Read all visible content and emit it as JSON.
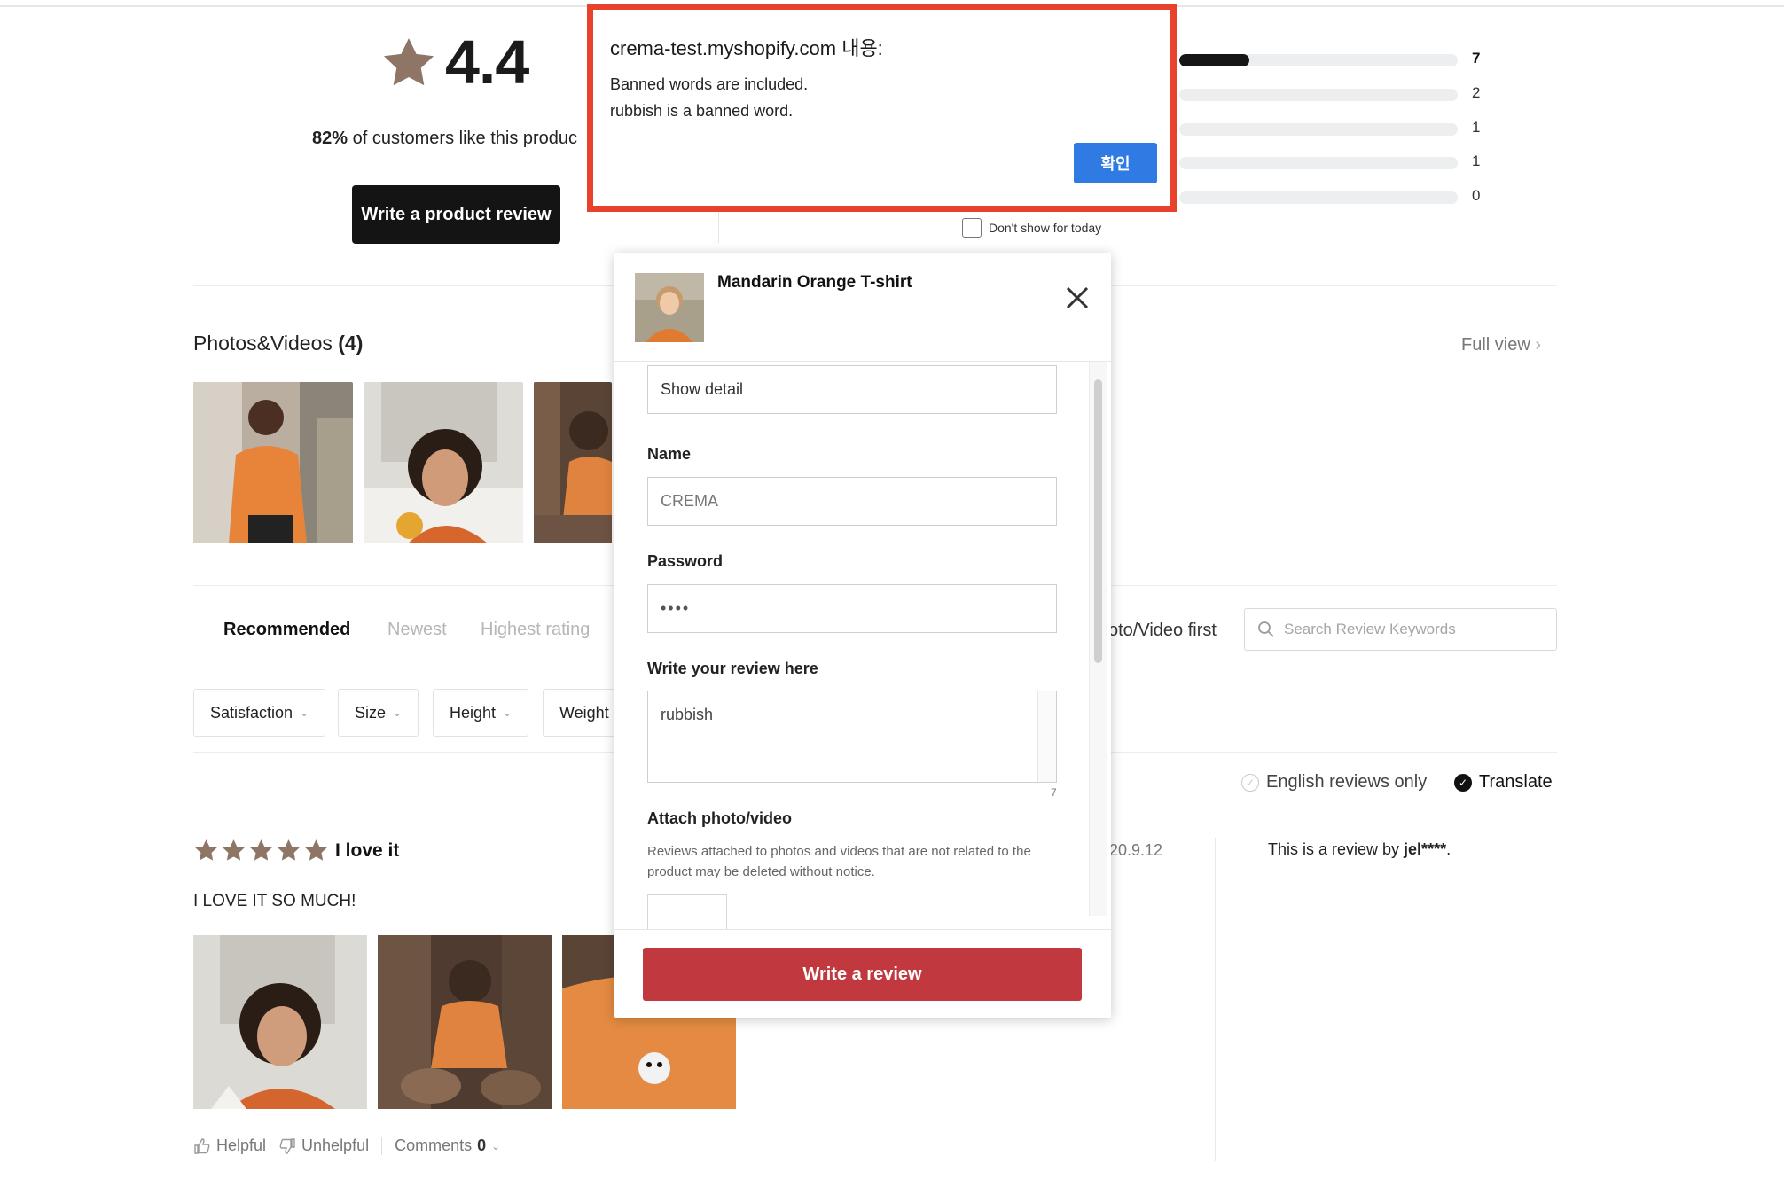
{
  "summary": {
    "average_rating": "4.4",
    "like_percent": "82%",
    "like_text": " of customers like this produc",
    "write_product_review_label": "Write a product review",
    "distribution": [
      {
        "count": "7",
        "fraction": 0.25
      },
      {
        "count": "2",
        "fraction": 0
      },
      {
        "count": "1",
        "fraction": 0
      },
      {
        "count": "1",
        "fraction": 0
      },
      {
        "count": "0",
        "fraction": 0
      }
    ]
  },
  "photos": {
    "title": "Photos&Videos",
    "count": "(4)",
    "full_view": "Full view"
  },
  "sort": {
    "options": [
      "Recommended",
      "Newest",
      "Highest rating"
    ],
    "active": "Recommended",
    "photo_video_first": "oto/Video first",
    "search_placeholder": "Search Review Keywords"
  },
  "filters": [
    "Satisfaction",
    "Size",
    "Height",
    "Weight"
  ],
  "toggles": {
    "english_only": "English reviews only",
    "translate": "Translate"
  },
  "review": {
    "stars": 5,
    "title": "I love it",
    "body": "I LOVE IT SO MUCH!",
    "date": "20.9.12",
    "by_prefix": "This is a review by ",
    "by_user": "jel****",
    "by_suffix": ".",
    "helpful": "Helpful",
    "unhelpful": "Unhelpful",
    "comments": "Comments",
    "comments_count": "0"
  },
  "modal": {
    "product_name": "Mandarin Orange T-shirt",
    "show_detail": "Show detail",
    "name_label": "Name",
    "name_value": "CREMA",
    "password_label": "Password",
    "password_value": "••••",
    "review_label": "Write your review here",
    "review_value": "rubbish",
    "char_count": "7",
    "attach_label": "Attach photo/video",
    "attach_note": "Reviews attached to photos and videos that are not related to the product may be deleted without notice.",
    "submit_label": "Write a review"
  },
  "alert": {
    "title": "crema-test.myshopify.com 내용:",
    "line1": "Banned words are included.",
    "line2": "rubbish is a banned word.",
    "ok_label": "확인",
    "dont_show": "Don't show for today"
  },
  "colors": {
    "star": "#8e7565",
    "submit": "#c1393f",
    "alert_border": "#e8412c",
    "ok_button": "#2f7be3"
  }
}
